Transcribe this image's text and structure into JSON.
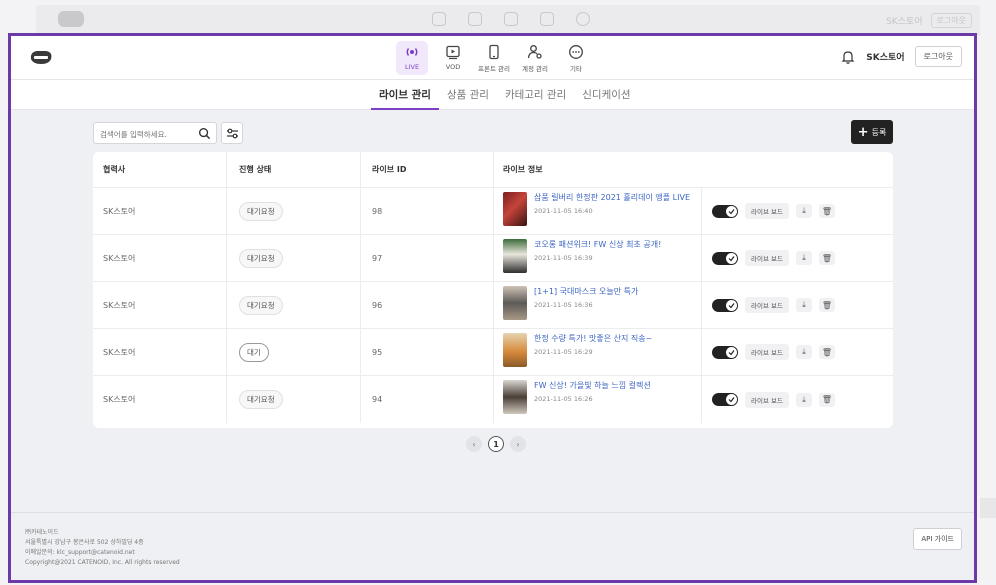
{
  "ghost": {
    "user_name": "SK스토어",
    "logout": "로그아웃"
  },
  "header": {
    "nav": [
      {
        "label": "LIVE",
        "icon": "live-icon",
        "active": true
      },
      {
        "label": "VOD",
        "icon": "vod-icon"
      },
      {
        "label": "프론트 관리",
        "icon": "mobile-icon"
      },
      {
        "label": "계정 관리",
        "icon": "user-settings-icon"
      },
      {
        "label": "기타",
        "icon": "more-icon"
      }
    ],
    "user_name": "SK스토어",
    "logout": "로그아웃"
  },
  "tabs": [
    {
      "label": "라이브 관리",
      "active": true
    },
    {
      "label": "상품 관리"
    },
    {
      "label": "카테고리 관리"
    },
    {
      "label": "신디케이션"
    }
  ],
  "toolbar": {
    "search_placeholder": "검색어를 입력하세요.",
    "register_label": "등록"
  },
  "table": {
    "headers": [
      "협력사",
      "진행 상태",
      "라이브 ID",
      "라이브 정보"
    ],
    "rows": [
      {
        "partner": "SK스토어",
        "status": "대기요청",
        "live_id": "98",
        "title": "삼품 릴버리 한정판 2021 홀리데이 앵플 LIVE",
        "time": "2021-11-05 16:40",
        "broadcast": "라이브 보드"
      },
      {
        "partner": "SK스토어",
        "status": "대기요청",
        "live_id": "97",
        "title": "코오롱 패션위크! FW 신상 최초 공개!",
        "time": "2021-11-05 16:39",
        "broadcast": "라이브 보드"
      },
      {
        "partner": "SK스토어",
        "status": "대기요청",
        "live_id": "96",
        "title": "[1+1] 국대마스크 오늘만 특가",
        "time": "2021-11-05 16:36",
        "broadcast": "라이브 보드"
      },
      {
        "partner": "SK스토어",
        "status": "대기",
        "live_id": "95",
        "title": "한정 수량 특가! 맛좋은 산지 직송~",
        "time": "2021-11-05 16:29",
        "broadcast": "라이브 보드"
      },
      {
        "partner": "SK스토어",
        "status": "대기요청",
        "live_id": "94",
        "title": "FW 신상! 가을빛 하늘 느낌 컬렉션",
        "time": "2021-11-05 16:26",
        "broadcast": "라이브 보드"
      }
    ]
  },
  "pagination": {
    "prev": "‹",
    "current": "1",
    "next": "›"
  },
  "footer": {
    "company": "㈜카테노이드",
    "address": "서울특별시 강남구 봉은사로 502 상하빌딩 4층",
    "email": "이메일문의: klc_support@catenoid.net",
    "copyright": "Copyright@2021 CATENOID, Inc. All rights reserved",
    "api_guide": "API 가이드"
  },
  "colors": {
    "accent": "#7a3fc4",
    "frame": "#6b3aa8",
    "link": "#3d66c4"
  }
}
